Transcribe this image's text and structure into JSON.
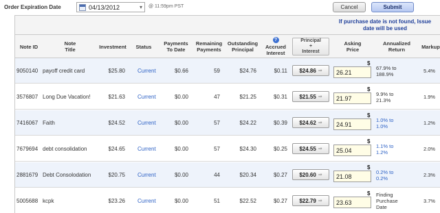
{
  "order": {
    "label": "Order Expiration Date",
    "date": "04/13/2012",
    "time_note": "@ 11:59pm PST",
    "cancel_label": "Cancel",
    "submit_label": "Submit"
  },
  "notice": "If purchase date is not found, Issue date will be used",
  "columns": {
    "note_id": "Note ID",
    "note_title": "Note\nTitle",
    "investment": "Investment",
    "status": "Status",
    "payments_to_date": "Payments\nTo Date",
    "remaining_payments": "Remaining\nPayments",
    "outstanding_principal": "Outstanding\nPrincipal",
    "accrued_interest": "Accrued\nInterest",
    "principal_interest": "Principal\n+\nInterest",
    "asking_price": "Asking\nPrice",
    "annualized_return": "Annualized\nReturn",
    "markup": "Markup"
  },
  "help_icon": "?",
  "rows": [
    {
      "note_id": "9050140",
      "title": "payoff credit card",
      "investment": "$25.80",
      "status": "Current",
      "payments_to_date": "$0.66",
      "remaining": "59",
      "outstanding": "$24.76",
      "accrued": "$0.11",
      "pi": "$24.86",
      "asking": "26.21",
      "annualized": "67.9% to\n188.9%",
      "annualized_blue": false,
      "markup": "5.4%"
    },
    {
      "note_id": "3576807",
      "title": "Long Due Vacation!",
      "investment": "$21.63",
      "status": "Current",
      "payments_to_date": "$0.00",
      "remaining": "47",
      "outstanding": "$21.25",
      "accrued": "$0.31",
      "pi": "$21.55",
      "asking": "21.97",
      "annualized": "9.9% to\n21.3%",
      "annualized_blue": false,
      "markup": "1.9%"
    },
    {
      "note_id": "7416067",
      "title": "Faith",
      "investment": "$24.52",
      "status": "Current",
      "payments_to_date": "$0.00",
      "remaining": "57",
      "outstanding": "$24.22",
      "accrued": "$0.39",
      "pi": "$24.62",
      "asking": "24.91",
      "annualized": "1.0% to\n1.0%",
      "annualized_blue": true,
      "markup": "1.2%"
    },
    {
      "note_id": "7679694",
      "title": "debt consolidation",
      "investment": "$24.65",
      "status": "Current",
      "payments_to_date": "$0.00",
      "remaining": "57",
      "outstanding": "$24.30",
      "accrued": "$0.25",
      "pi": "$24.55",
      "asking": "25.04",
      "annualized": "1.1% to\n1.2%",
      "annualized_blue": true,
      "markup": "2.0%"
    },
    {
      "note_id": "2881679",
      "title": "Debt Consolodation",
      "investment": "$20.75",
      "status": "Current",
      "payments_to_date": "$0.00",
      "remaining": "44",
      "outstanding": "$20.34",
      "accrued": "$0.27",
      "pi": "$20.60",
      "asking": "21.08",
      "annualized": "0.2% to\n0.2%",
      "annualized_blue": true,
      "markup": "2.3%"
    },
    {
      "note_id": "5005688",
      "title": "kcpk",
      "investment": "$23.26",
      "status": "Current",
      "payments_to_date": "$0.00",
      "remaining": "51",
      "outstanding": "$22.52",
      "accrued": "$0.27",
      "pi": "$22.79",
      "asking": "23.63",
      "annualized": "Finding\nPurchase\nDate",
      "annualized_blue": false,
      "markup": "3.7%"
    }
  ],
  "colors": {
    "link": "#2a5fc4",
    "notice": "#1f3f9a",
    "alt_row": "#eef3fb",
    "asking_bg": "#fffde6"
  }
}
